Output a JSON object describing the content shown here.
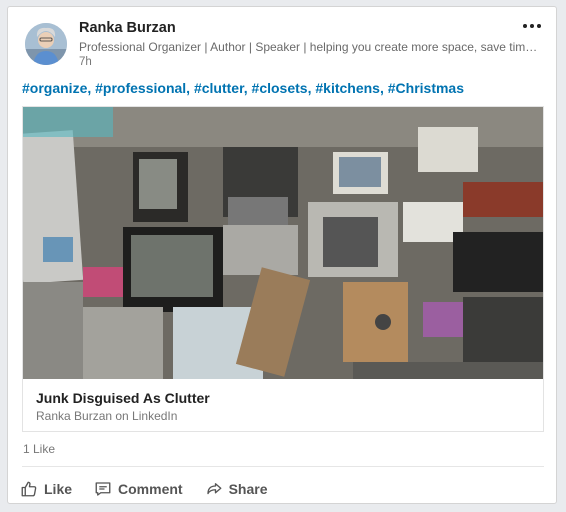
{
  "post": {
    "author_name": "Ranka Burzan",
    "author_headline": "Professional Organizer | Author | Speaker | helping you create more space, save time and reduce stress",
    "time": "7h",
    "more_icon": "more-horizontal-icon",
    "hashtags": [
      {
        "label": "#organize"
      },
      {
        "label": "#professional"
      },
      {
        "label": "#clutter"
      },
      {
        "label": "#closets"
      },
      {
        "label": "#kitchens"
      },
      {
        "label": "#Christmas"
      }
    ],
    "hashtag_separator": ",",
    "article": {
      "title": "Junk Disguised As Clutter",
      "source": "Ranka Burzan on LinkedIn"
    },
    "likes_count": "1 Like",
    "actions": {
      "like_label": "Like",
      "comment_label": "Comment",
      "share_label": "Share"
    }
  },
  "colors": {
    "link": "#0073b1",
    "text_primary": "#222222",
    "text_secondary": "#777777",
    "background": "#e9ebee"
  }
}
